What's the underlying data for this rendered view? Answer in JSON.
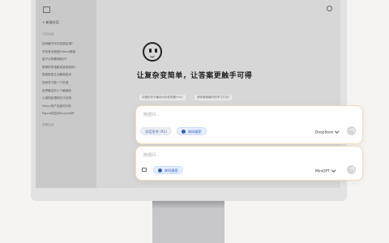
{
  "sidebar": {
    "new_chat": "+ 新建对话",
    "section_recent": "今天对话",
    "history": [
      "如何解决写作灵感枯竭?",
      "开发有关新型Python框架",
      "量子计算基础知识?",
      "推荐好的电影或游戏如何?",
      "智能家居生活最新技术",
      "如何学习新一门外语",
      "世界著名的十个最美丽",
      "人类的起源和古代文明",
      "Vision的产品如何分析",
      "Figure的应用Scopeai好"
    ],
    "section_more": "查看全部"
  },
  "main": {
    "slogan": "让复杂变简单，让答案更触手可得",
    "suggestions": [
      "中国历史中最伟大的发明是什么?",
      "请你推荐最好的学习方法?"
    ]
  },
  "composer_primary": {
    "placeholder": "随便问...",
    "deep_think_label": "深度思考 (R1)",
    "web_search_label": "联网搜索",
    "model": "DeepSeek"
  },
  "composer_secondary": {
    "placeholder": "随便问...",
    "web_search_label": "联网搜索",
    "model": "MiniGPT"
  },
  "icons": [
    "sidebar-toggle-icon",
    "settings-icon",
    "smiley-logo-icon",
    "globe-icon",
    "send-icon",
    "attach-icon",
    "chevron-down-icon"
  ],
  "colors": {
    "accent": "#2f5fc8",
    "card_border": "#f1d9bd",
    "page_bg": "#f5f4f2"
  }
}
